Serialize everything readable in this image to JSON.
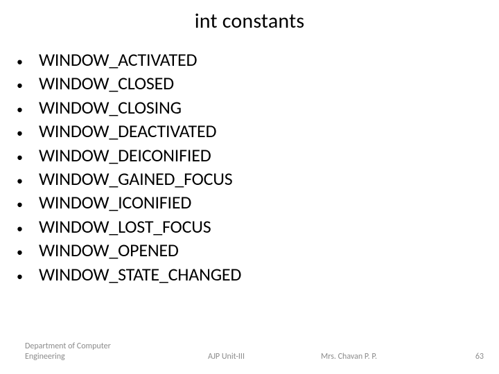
{
  "title": "int constants",
  "items": [
    "WINDOW_ACTIVATED",
    "WINDOW_CLOSED",
    "WINDOW_CLOSING",
    "WINDOW_DEACTIVATED",
    "WINDOW_DEICONIFIED",
    "WINDOW_GAINED_FOCUS",
    "WINDOW_ICONIFIED",
    "WINDOW_LOST_FOCUS",
    "WINDOW_OPENED",
    "WINDOW_STATE_CHANGED"
  ],
  "footer": {
    "department_line1": "Department of Computer",
    "department_line2": "Engineering",
    "unit": "AJP Unit-III",
    "author": "Mrs. Chavan P. P.",
    "page_number": "63"
  }
}
